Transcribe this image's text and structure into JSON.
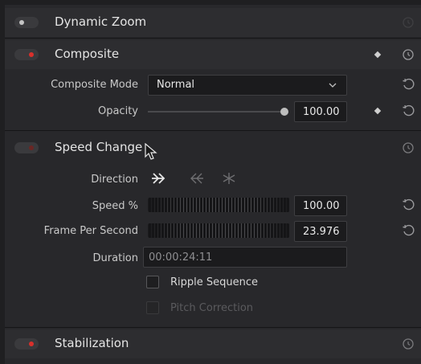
{
  "sections": {
    "dynamic_zoom": {
      "title": "Dynamic Zoom",
      "enabled": false
    },
    "composite": {
      "title": "Composite",
      "enabled": true,
      "composite_mode": {
        "label": "Composite Mode",
        "value": "Normal"
      },
      "opacity": {
        "label": "Opacity",
        "value": "100.00",
        "level": 1.0
      }
    },
    "speed_change": {
      "title": "Speed Change",
      "enabled": false,
      "direction": {
        "label": "Direction",
        "options": [
          "forward",
          "reverse",
          "freeze"
        ],
        "selected": "forward"
      },
      "speed": {
        "label": "Speed %",
        "value": "100.00"
      },
      "fps": {
        "label": "Frame Per Second",
        "value": "23.976"
      },
      "duration": {
        "label": "Duration",
        "value": "00:00:24:11"
      },
      "ripple_sequence": {
        "label": "Ripple Sequence",
        "checked": false
      },
      "pitch_correction": {
        "label": "Pitch Correction",
        "checked": false,
        "disabled": true
      }
    },
    "stabilization": {
      "title": "Stabilization",
      "enabled": true
    }
  },
  "colors": {
    "accent_red": "#d9302c",
    "off_dot": "#bdbdbd",
    "dim_red": "#6a2624"
  }
}
